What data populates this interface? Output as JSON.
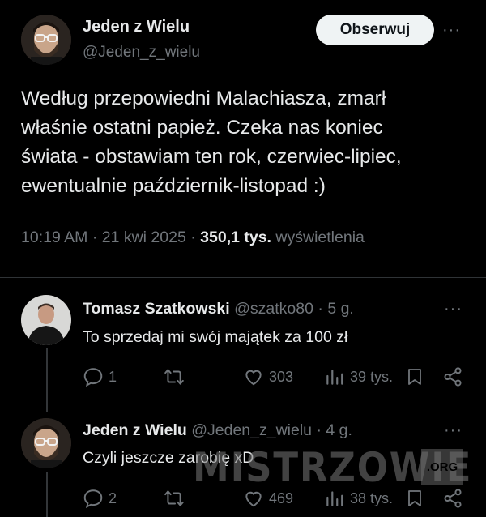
{
  "main_tweet": {
    "author_name": "Jeden z Wielu",
    "author_handle": "@Jeden_z_wielu",
    "follow_label": "Obserwuj",
    "more_label": "···",
    "text_lines": [
      "Według przepowiedni Malachiasza, zmarł",
      "właśnie ostatni papież. Czeka nas koniec",
      "świata - obstawiam ten rok, czerwiec-lipiec,",
      "ewentualnie październik-listopad :)"
    ],
    "time": "10:19 AM",
    "date": "21 kwi 2025",
    "views_count": "350,1 tys.",
    "views_label": "wyświetlenia",
    "sep": "·"
  },
  "replies": [
    {
      "name": "Tomasz Szatkowski",
      "handle": "@szatko80",
      "age": "5 g.",
      "text": "To sprzedaj mi swój majątek za 100 zł",
      "replies": "1",
      "retweets": "",
      "likes": "303",
      "views": "39 tys."
    },
    {
      "name": "Jeden z Wielu",
      "handle": "@Jeden_z_wielu",
      "age": "4 g.",
      "text": "Czyli jeszcze zarobię xD",
      "replies": "2",
      "retweets": "",
      "likes": "469",
      "views": "38 tys."
    }
  ],
  "watermark": {
    "text": "MISTRZOWIE",
    "suffix": ".ORG"
  },
  "colors": {
    "background": "#000000",
    "text": "#e7e9ea",
    "secondary": "#71767b",
    "divider": "#2f3336",
    "button_bg": "#eff3f4"
  }
}
